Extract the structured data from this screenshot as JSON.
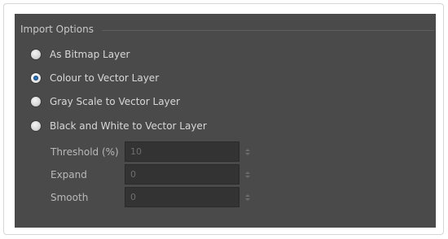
{
  "group": {
    "title": "Import Options"
  },
  "options": [
    {
      "label": "As Bitmap Layer",
      "selected": false
    },
    {
      "label": "Colour to Vector Layer",
      "selected": true
    },
    {
      "label": "Gray Scale to Vector Layer",
      "selected": false
    },
    {
      "label": "Black and White to Vector Layer",
      "selected": false
    }
  ],
  "fields": {
    "threshold": {
      "label": "Threshold (%)",
      "value": "10"
    },
    "expand": {
      "label": "Expand",
      "value": "0"
    },
    "smooth": {
      "label": "Smooth",
      "value": "0"
    }
  },
  "colors": {
    "panel_bg": "#4a4a4a",
    "radio_selected_dot": "#2d6fb0"
  }
}
